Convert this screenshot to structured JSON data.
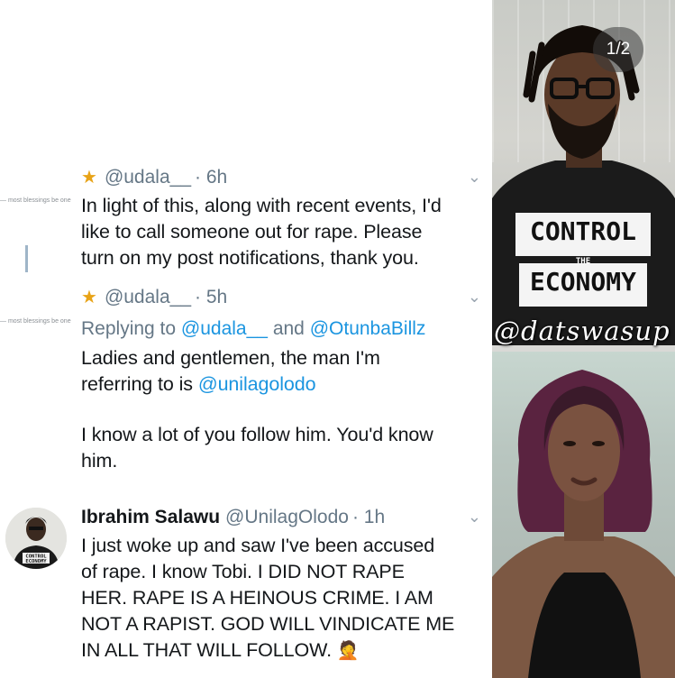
{
  "counter": "1/2",
  "watermark": "@datswasup",
  "tshirt": {
    "line1": "CONTROL",
    "line2": "THE",
    "line3": "ECONOMY"
  },
  "avatar_shirt": {
    "line1": "CONTROL",
    "line2": "ECONOMY"
  },
  "tweets": [
    {
      "handle": "@udala__",
      "time": "· 6h",
      "lines": [
        "In light of this, along with recent events, I'd",
        "like to call someone out for rape. Please",
        "turn on my post notifications, thank you."
      ]
    },
    {
      "handle": "@udala__",
      "time": "· 5h",
      "reply_prefix": "Replying to",
      "reply_user1": "@udala__",
      "reply_and": "and",
      "reply_user2": "@OtunbaBillz",
      "line1": "Ladies and gentlemen, the man I'm",
      "line2_prefix": "referring to is",
      "line2_link": "@unilagolodo",
      "line3": "I know a lot of you follow him. You'd know",
      "line4": "him."
    },
    {
      "name": "Ibrahim Salawu",
      "handle": "@UnilagOlodo",
      "time": "· 1h",
      "lines": [
        "I just woke up and saw I've been accused",
        "of rape. I know Tobi. I DID NOT RAPE",
        "HER. RAPE IS A HEINOUS CRIME. I AM",
        "NOT A RAPIST. GOD WILL VINDICATE ME",
        "IN ALL THAT WILL FOLLOW."
      ]
    }
  ]
}
